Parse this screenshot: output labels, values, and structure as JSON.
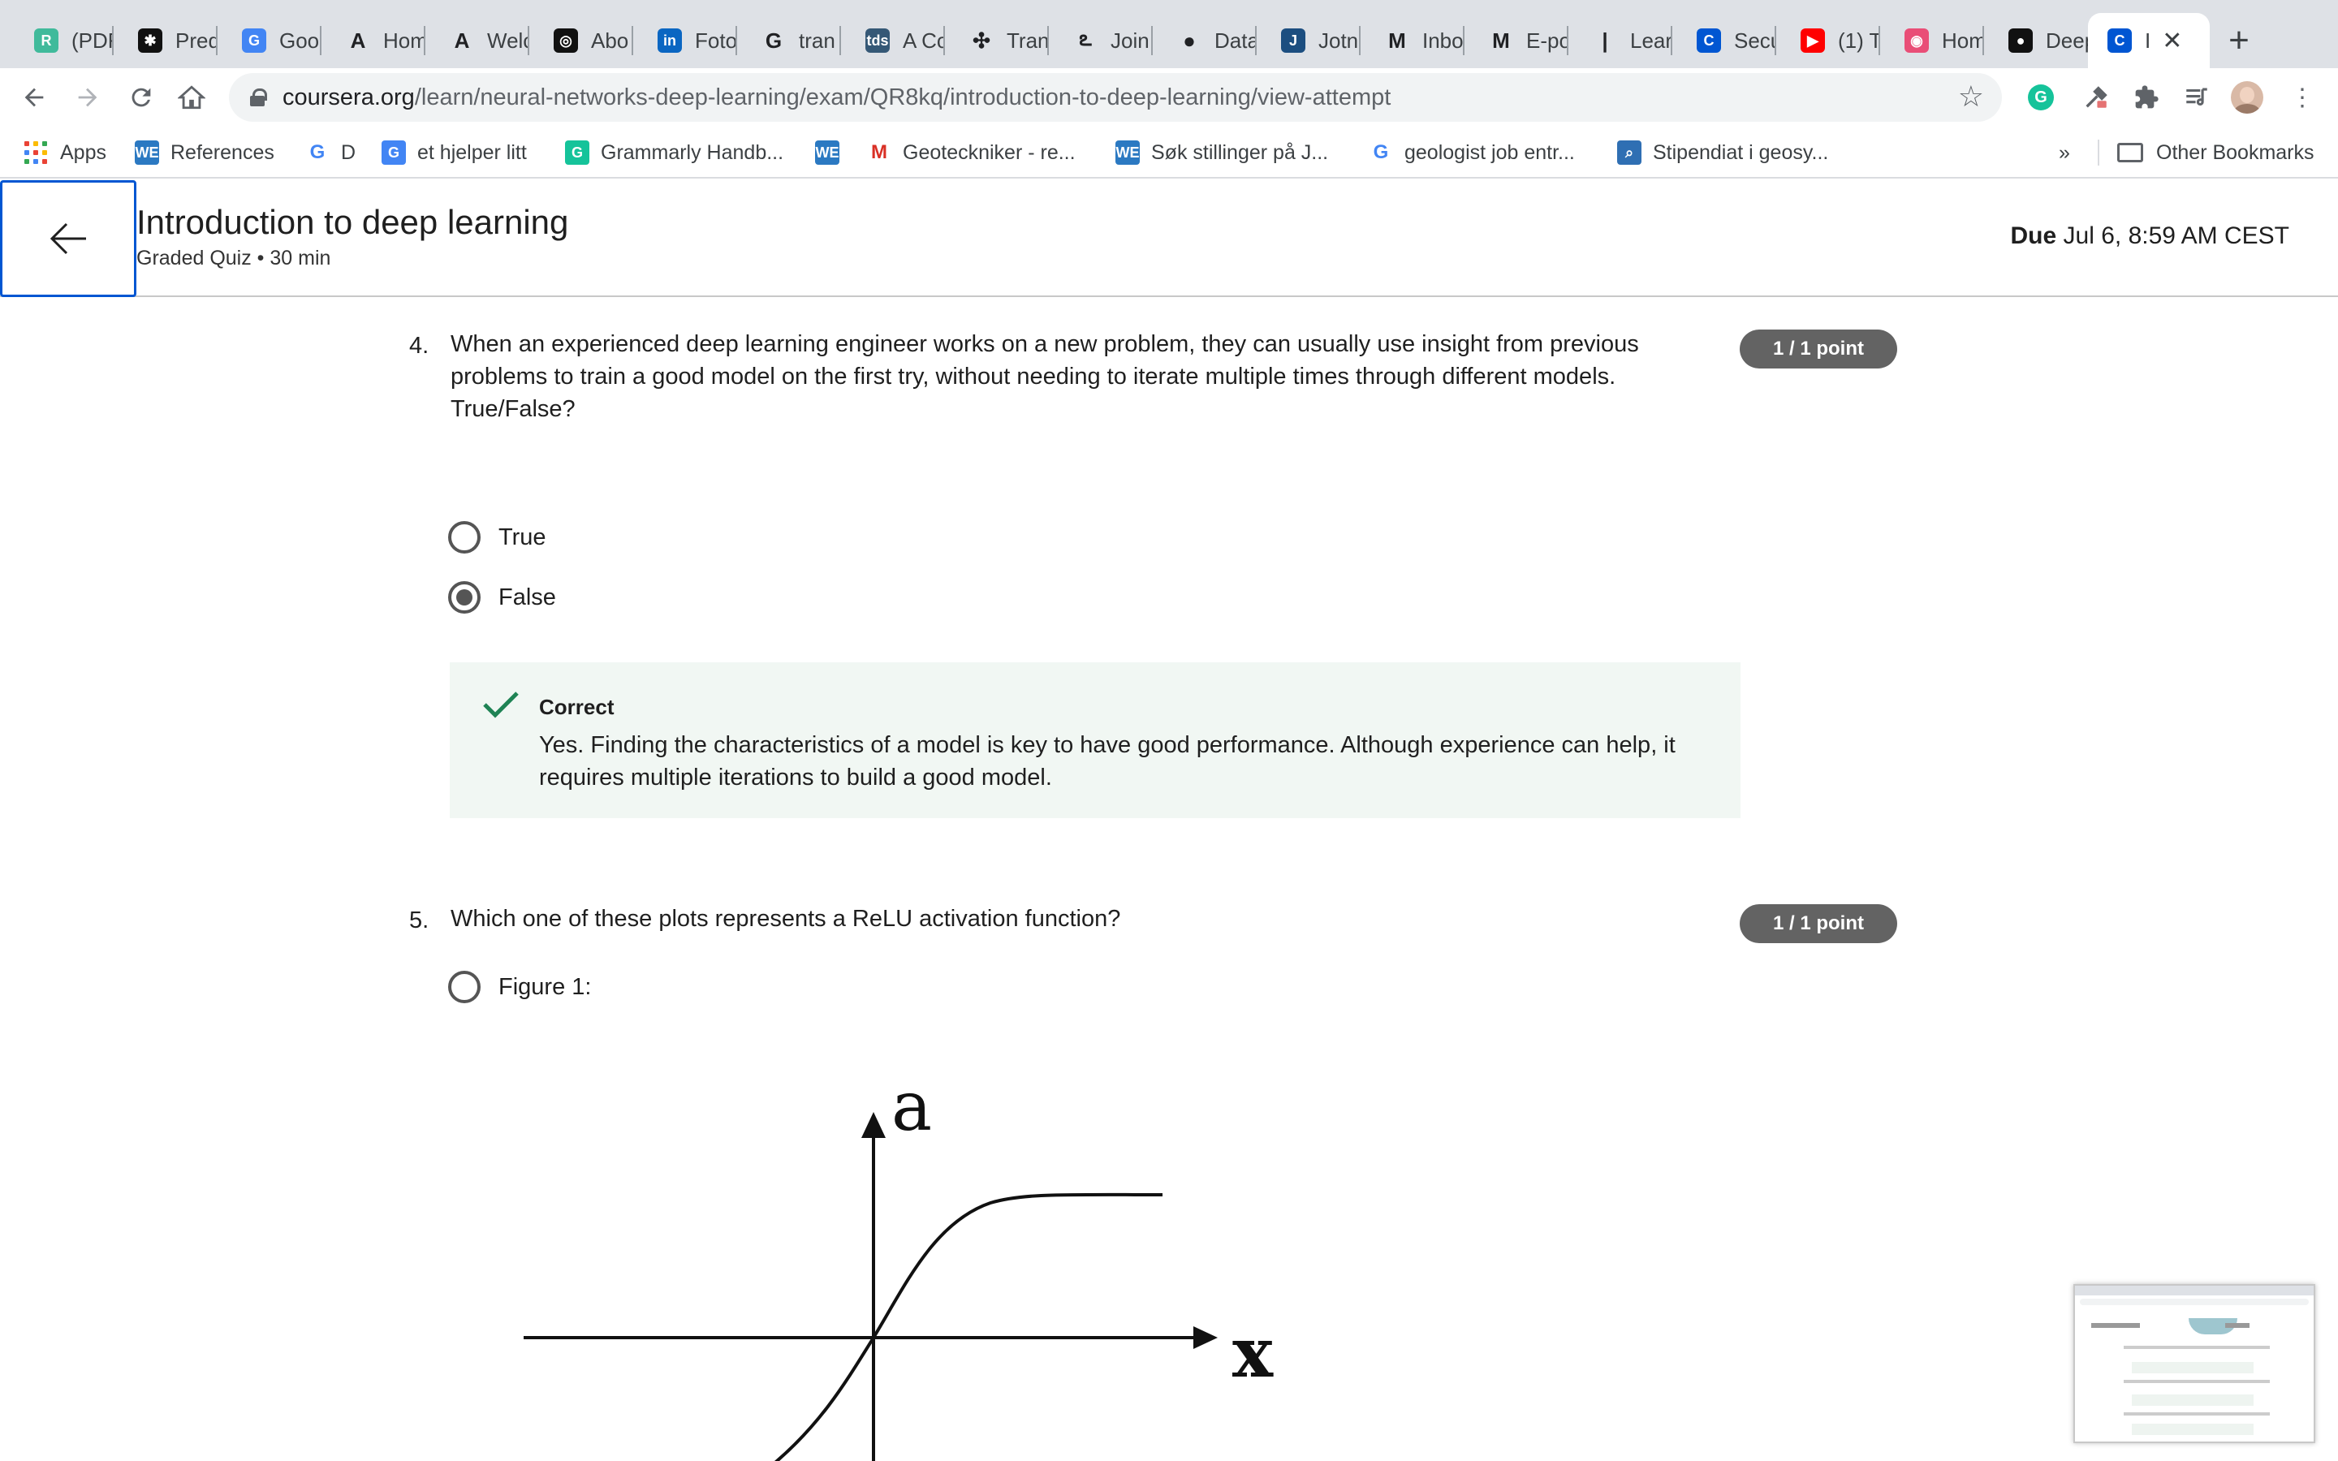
{
  "browser": {
    "tabs": [
      {
        "label": "(PDF",
        "icon": "researchgate-icon",
        "fav_text": "R",
        "color": "#40ba9b"
      },
      {
        "label": "Pred",
        "icon": "gear-icon",
        "fav_text": "✱",
        "color": "#111111"
      },
      {
        "label": "Goo",
        "icon": "google-translate-icon",
        "fav_text": "G",
        "color": "#4285f4"
      },
      {
        "label": "Hom",
        "icon": "letter-a-icon",
        "fav_text": "A",
        "color": "#ffffff"
      },
      {
        "label": "Welc",
        "icon": "letter-a-icon",
        "fav_text": "A",
        "color": "#ffffff"
      },
      {
        "label": "Abo",
        "icon": "spiral-icon",
        "fav_text": "◎",
        "color": "#111111"
      },
      {
        "label": "Foto",
        "icon": "linkedin-icon",
        "fav_text": "in",
        "color": "#0a66c2"
      },
      {
        "label": "tran",
        "icon": "google-icon",
        "fav_text": "G",
        "color": "#ffffff"
      },
      {
        "label": "A Co",
        "icon": "tds-icon",
        "fav_text": "tds",
        "color": "#355876"
      },
      {
        "label": "Tran",
        "icon": "bee-icon",
        "fav_text": "✣",
        "color": "#ffffff"
      },
      {
        "label": "Join",
        "icon": "swoosh-icon",
        "fav_text": "ఽ",
        "color": "#ffffff"
      },
      {
        "label": "Data",
        "icon": "drop-icon",
        "fav_text": "●",
        "color": "#ffffff"
      },
      {
        "label": "Jotn",
        "icon": "letter-j-icon",
        "fav_text": "J",
        "color": "#1c4e80"
      },
      {
        "label": "Inbo",
        "icon": "gmail-icon",
        "fav_text": "M",
        "color": "#ffffff"
      },
      {
        "label": "E-po",
        "icon": "gmail-icon",
        "fav_text": "M",
        "color": "#ffffff"
      },
      {
        "label": "Lear",
        "icon": "bars-icon",
        "fav_text": "|",
        "color": "#ffffff"
      },
      {
        "label": "Secu",
        "icon": "coursera-icon",
        "fav_text": "C",
        "color": "#0056d2"
      },
      {
        "label": "(1) T",
        "icon": "youtube-icon",
        "fav_text": "▶",
        "color": "#ff0000"
      },
      {
        "label": "Hom",
        "icon": "target-icon",
        "fav_text": "◉",
        "color": "#e94e77"
      },
      {
        "label": "Deep",
        "icon": "github-icon",
        "fav_text": "●",
        "color": "#111111"
      },
      {
        "label": "I",
        "icon": "coursera-icon",
        "fav_text": "C",
        "color": "#0056d2",
        "active": true
      }
    ],
    "new_tab": "+",
    "url_host": "coursera.org",
    "url_path": "/learn/neural-networks-deep-learning/exam/QR8kq/introduction-to-deep-learning/view-attempt",
    "bookmarks": [
      {
        "label": "Apps",
        "icon": "apps-grid-icon"
      },
      {
        "label": "References",
        "icon": "we-icon",
        "fav_text": "WE",
        "color": "#2b79c2"
      },
      {
        "label": "D",
        "icon": "google-icon",
        "fav_text": "G",
        "color": "#ffffff"
      },
      {
        "label": "et hjelper litt",
        "icon": "google-translate-icon",
        "fav_text": "G",
        "color": "#4285f4"
      },
      {
        "label": "Grammarly Handb...",
        "icon": "grammarly-icon",
        "fav_text": "G",
        "color": "#15c39a"
      },
      {
        "label": "",
        "icon": "we-icon",
        "fav_text": "WE",
        "color": "#2b79c2"
      },
      {
        "label": "Geoteckniker - re...",
        "icon": "gmail-icon",
        "fav_text": "M",
        "color": "#ffffff"
      },
      {
        "label": "Søk stillinger på J...",
        "icon": "we-icon",
        "fav_text": "WE",
        "color": "#2b79c2"
      },
      {
        "label": "geologist job entr...",
        "icon": "google-icon",
        "fav_text": "G",
        "color": "#ffffff"
      },
      {
        "label": "Stipendiat i geosy...",
        "icon": "search-box-icon",
        "fav_text": "⌕",
        "color": "#2f6fb3"
      }
    ],
    "overflow": "»",
    "other_bookmarks": "Other Bookmarks"
  },
  "quiz": {
    "title": "Introduction to deep learning",
    "subtitle": "Graded Quiz • 30 min",
    "due_label": "Due",
    "due_value": "Jul 6, 8:59 AM CEST"
  },
  "questions": [
    {
      "number": "4.",
      "text": "When an experienced deep learning engineer works on a new problem, they can usually use insight from previous problems to train a good model on the first try, without needing to iterate multiple times through different models. True/False?",
      "points": "1 / 1 point",
      "options": [
        {
          "label": "True",
          "selected": false
        },
        {
          "label": "False",
          "selected": true
        }
      ],
      "feedback_title": "Correct",
      "feedback_text": "Yes. Finding the characteristics of a model is key to have good performance. Although experience can help, it requires multiple iterations to build a good model."
    },
    {
      "number": "5.",
      "text": "Which one of these plots represents a ReLU activation function?",
      "points": "1 / 1 point",
      "options": [
        {
          "label": "Figure 1:",
          "selected": false
        }
      ],
      "figure": {
        "y_label": "a",
        "x_label": "x",
        "curve": "sigmoid"
      }
    }
  ],
  "colors": {
    "accent": "#0056d2",
    "points_badge": "#636363",
    "feedback_bg": "#f1f7f3",
    "check": "#1f8354"
  }
}
